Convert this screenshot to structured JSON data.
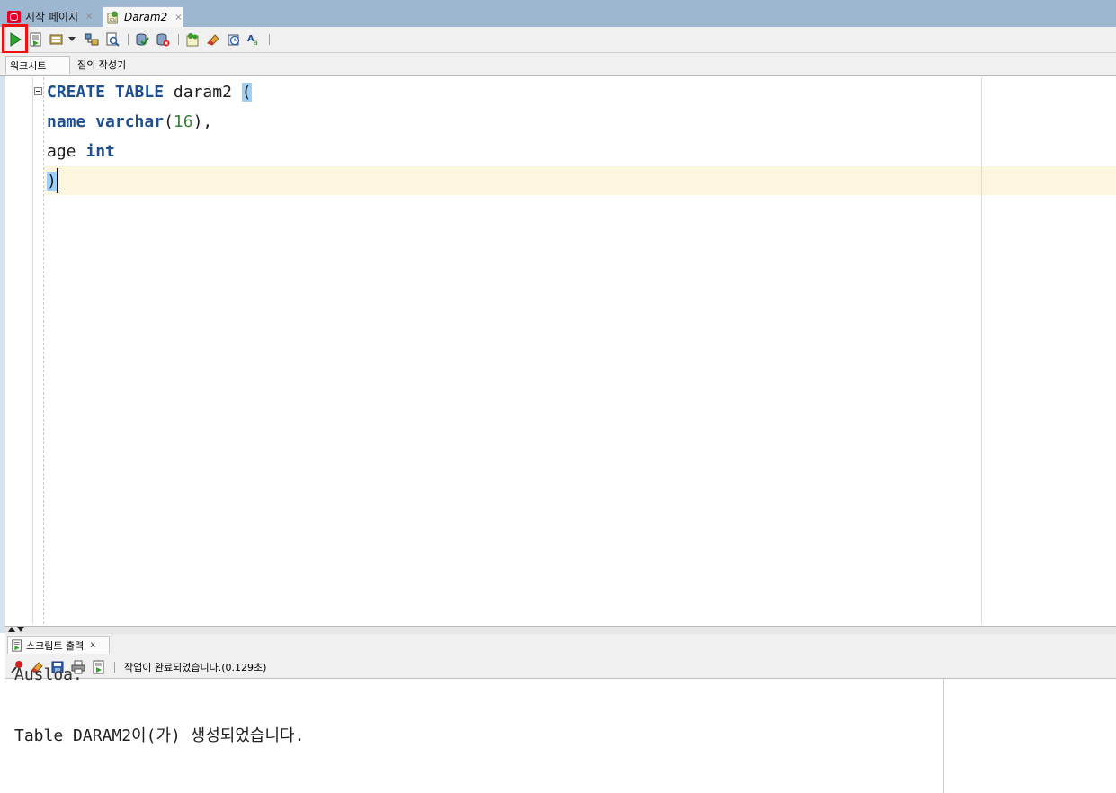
{
  "tabs": [
    {
      "label": "시작 페이지",
      "close": "×",
      "active": false
    },
    {
      "label": "Daram2",
      "close": "×",
      "active": true
    }
  ],
  "toolbar": {
    "buttons": [
      "run-statement",
      "run-script",
      "autotrace",
      "explain-plan",
      "sql-tuning",
      "commit",
      "rollback",
      "unshared-sql",
      "clear",
      "sql-history",
      "format-case"
    ]
  },
  "subtabs": [
    "워크시트",
    "질의 작성기"
  ],
  "editor": {
    "lines": [
      [
        {
          "t": "CREATE",
          "c": "kw"
        },
        {
          "t": " ",
          "c": ""
        },
        {
          "t": "TABLE",
          "c": "kw"
        },
        {
          "t": " daram2 ",
          "c": ""
        },
        {
          "t": "(",
          "c": "paren-hl"
        }
      ],
      [
        {
          "t": "name",
          "c": "kw"
        },
        {
          "t": " ",
          "c": ""
        },
        {
          "t": "varchar",
          "c": "kw"
        },
        {
          "t": "(",
          "c": ""
        },
        {
          "t": "16",
          "c": "num"
        },
        {
          "t": "),",
          "c": ""
        }
      ],
      [
        {
          "t": "age ",
          "c": ""
        },
        {
          "t": "int",
          "c": "kw"
        }
      ],
      [
        {
          "t": ")",
          "c": "paren-hl"
        }
      ]
    ]
  },
  "output": {
    "tab_label": "스크립트 출력",
    "tab_close": "x",
    "status": "작업이 완료되었습니다.(0.129초)",
    "partial_line": "Ausloa.",
    "result_line": "Table DARAM2이(가) 생성되었습니다."
  },
  "colors": {
    "tab_strip": "#9eb7d1",
    "keyword": "#1f4f8f",
    "number": "#3a7e3a",
    "current_line": "#fdf6df",
    "paren_match": "#9ecff7",
    "run_highlight": "#ee1111"
  }
}
